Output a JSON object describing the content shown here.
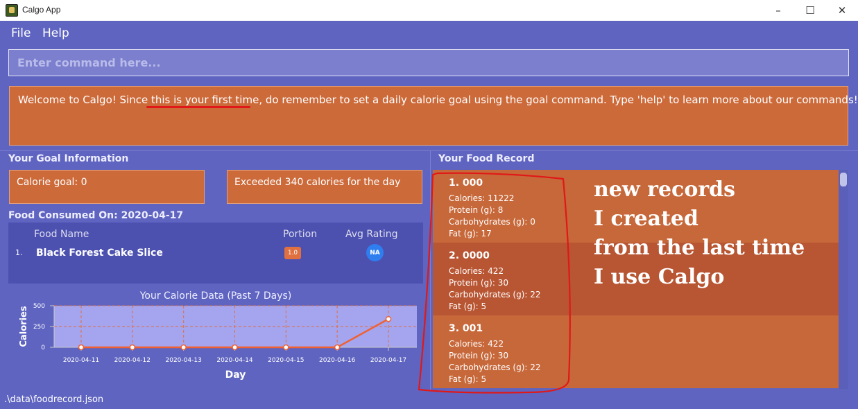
{
  "window": {
    "title": "Calgo App",
    "minimize_glyph": "–",
    "maximize_glyph": "☐",
    "close_glyph": "✕"
  },
  "menu": {
    "file": "File",
    "help": "Help"
  },
  "command": {
    "placeholder": "Enter command here..."
  },
  "result": {
    "text": "Welcome to Calgo! Since this is your first time, do remember to set a daily calorie goal using the goal command. Type 'help' to learn more about our commands!"
  },
  "goal": {
    "header": "Your Goal Information",
    "calorie_goal": "Calorie goal: 0",
    "status": "Exceeded 340 calories for the day"
  },
  "consumed": {
    "header": "Food Consumed On: 2020-04-17",
    "columns": {
      "food": "Food Name",
      "portion": "Portion",
      "rating": "Avg Rating"
    },
    "rows": [
      {
        "num": "1.",
        "food": "Black Forest Cake Slice",
        "portion": "1.0",
        "rating": "NA"
      }
    ]
  },
  "records": {
    "header": "Your Food Record",
    "items": [
      {
        "title": "1.  000",
        "calories": "Calories: 11222",
        "protein": "Protein (g): 8",
        "carbs": "Carbohydrates (g): 0",
        "fat": "Fat (g): 17"
      },
      {
        "title": "2.  0000",
        "calories": "Calories: 422",
        "protein": "Protein (g): 30",
        "carbs": "Carbohydrates (g): 22",
        "fat": "Fat (g): 5"
      },
      {
        "title": "3.  001",
        "calories": "Calories: 422",
        "protein": "Protein (g): 30",
        "carbs": "Carbohydrates (g): 22",
        "fat": "Fat (g): 5"
      }
    ]
  },
  "annotation": {
    "lines": [
      "new records",
      "I created",
      "from the last time",
      "I use Calgo"
    ],
    "color": "#e01818"
  },
  "status": {
    "path": ".\\data\\foodrecord.json"
  },
  "colors": {
    "background": "#5f64c0",
    "card": "#cd6a3a",
    "card_alt": "#b85532",
    "accent_line": "#f06030"
  },
  "chart_data": {
    "type": "line",
    "title": "Your Calorie Data (Past 7 Days)",
    "xlabel": "Day",
    "ylabel": "Calories",
    "categories": [
      "2020-04-11",
      "2020-04-12",
      "2020-04-13",
      "2020-04-14",
      "2020-04-15",
      "2020-04-16",
      "2020-04-17"
    ],
    "values": [
      0,
      0,
      0,
      0,
      0,
      0,
      340
    ],
    "ylim": [
      0,
      500
    ],
    "yticks": [
      "0",
      "250",
      "500"
    ],
    "grid": true
  }
}
